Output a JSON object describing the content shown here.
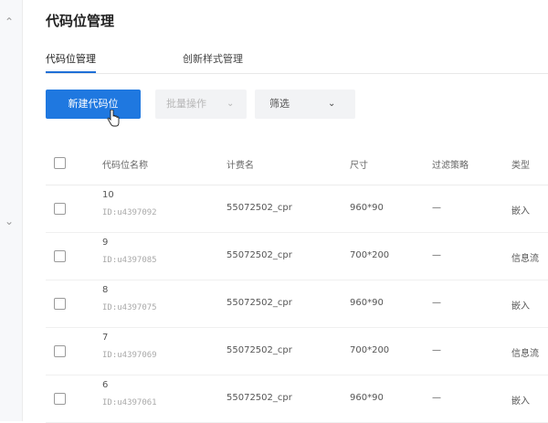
{
  "page": {
    "title": "代码位管理"
  },
  "tabs": [
    {
      "label": "代码位管理",
      "active": true
    },
    {
      "label": "创新样式管理",
      "active": false
    }
  ],
  "toolbar": {
    "new_label": "新建代码位",
    "batch_label": "批量操作",
    "filter_label": "筛选"
  },
  "table": {
    "headers": [
      "代码位名称",
      "计费名",
      "尺寸",
      "过滤策略",
      "类型"
    ],
    "rows": [
      {
        "name": "10",
        "id": "ID:u4397092",
        "billing": "55072502_cpr",
        "size": "960*90",
        "filter": "—",
        "type": "嵌入"
      },
      {
        "name": "9",
        "id": "ID:u4397085",
        "billing": "55072502_cpr",
        "size": "700*200",
        "filter": "—",
        "type": "信息流"
      },
      {
        "name": "8",
        "id": "ID:u4397075",
        "billing": "55072502_cpr",
        "size": "960*90",
        "filter": "—",
        "type": "嵌入"
      },
      {
        "name": "7",
        "id": "ID:u4397069",
        "billing": "55072502_cpr",
        "size": "700*200",
        "filter": "—",
        "type": "信息流"
      },
      {
        "name": "6",
        "id": "ID:u4397061",
        "billing": "55072502_cpr",
        "size": "960*90",
        "filter": "—",
        "type": "嵌入"
      }
    ]
  },
  "colors": {
    "primary": "#1f78e0",
    "tab_indicator": "#1f6fd6"
  }
}
